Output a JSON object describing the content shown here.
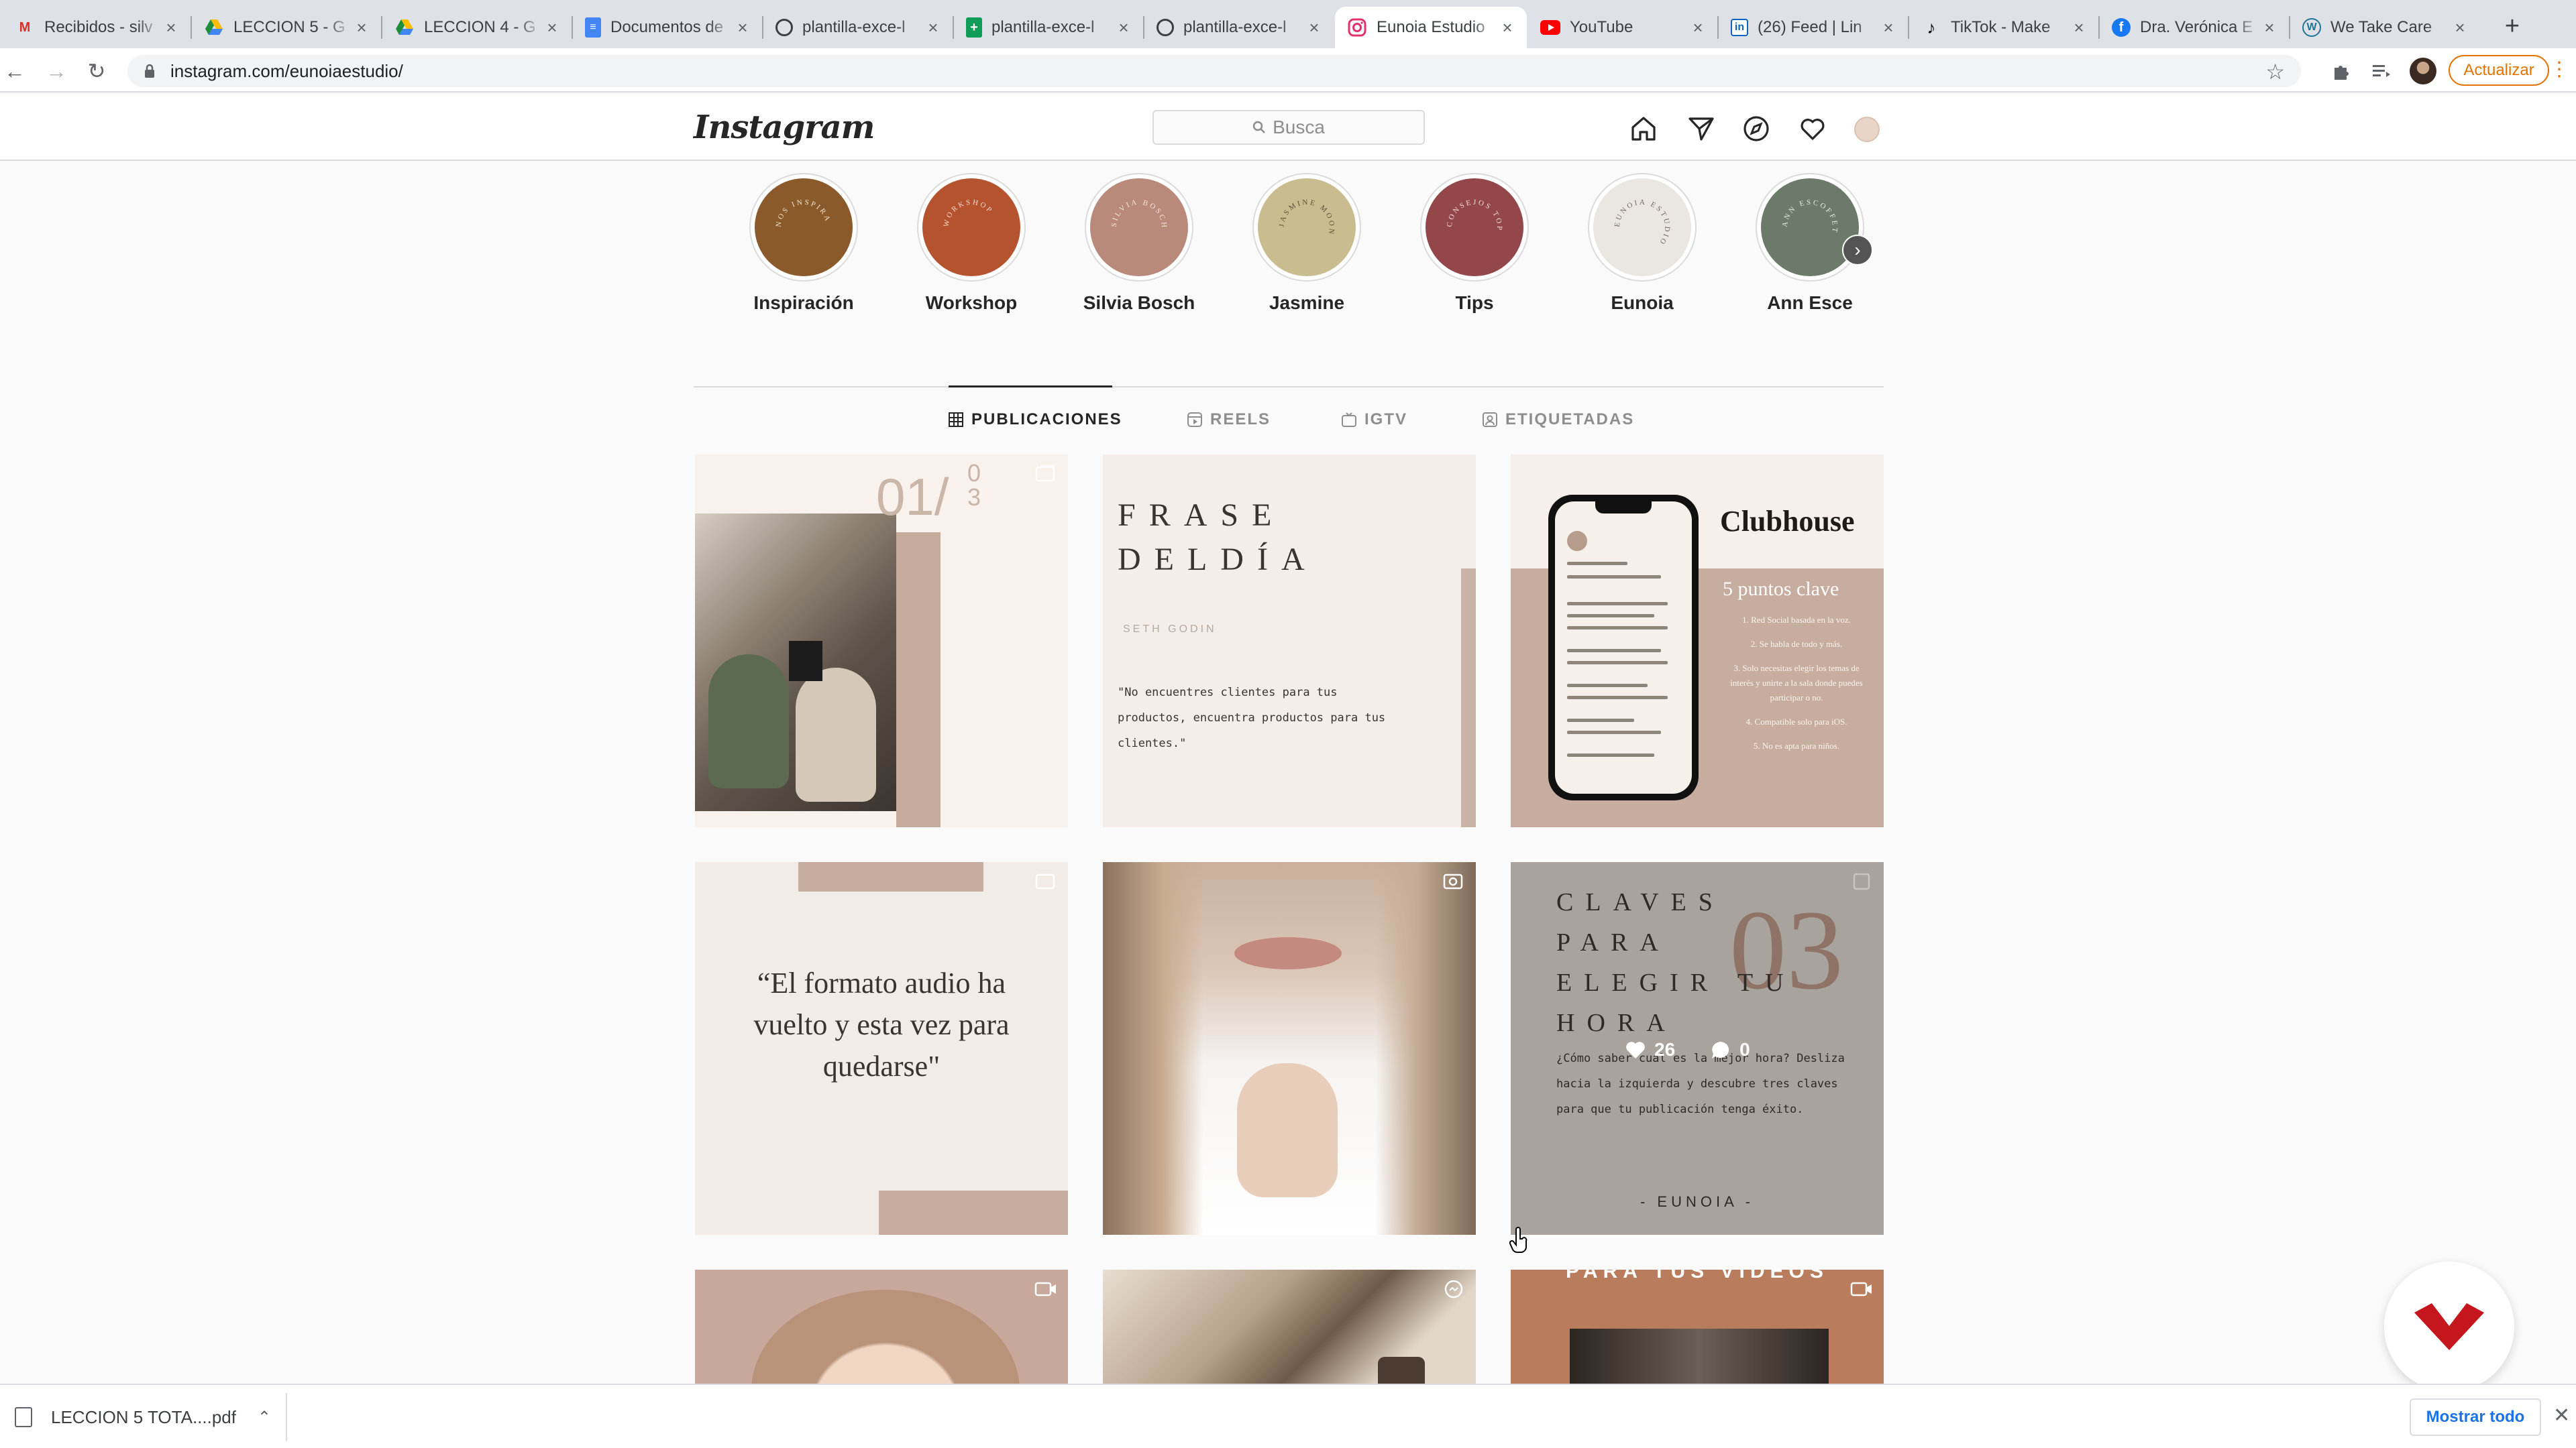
{
  "browser": {
    "tabs": [
      {
        "title": "Recibidos - silv",
        "icon": "gmail-icon",
        "color": "#d93025",
        "active": false
      },
      {
        "title": "LECCION 5 - G",
        "icon": "google-drive-icon",
        "color": "#1e8e3e",
        "active": false
      },
      {
        "title": "LECCION 4 - G",
        "icon": "google-drive-icon",
        "color": "#1e8e3e",
        "active": false
      },
      {
        "title": "Documentos de",
        "icon": "google-docs-icon",
        "color": "#4285f4",
        "active": false
      },
      {
        "title": "plantilla-exce-l",
        "icon": "globe-icon",
        "color": "#3c4043",
        "active": false
      },
      {
        "title": "plantilla-exce-l",
        "icon": "google-sheets-icon",
        "color": "#0f9d58",
        "active": false
      },
      {
        "title": "plantilla-exce-l",
        "icon": "globe-icon",
        "color": "#3c4043",
        "active": false
      },
      {
        "title": "Eunoia Estudio",
        "icon": "instagram-icon",
        "color": "#e1306c",
        "active": true
      },
      {
        "title": "YouTube",
        "icon": "youtube-icon",
        "color": "#ff0000",
        "active": false
      },
      {
        "title": "(26) Feed | Lin",
        "icon": "linkedin-icon",
        "color": "#0a66c2",
        "active": false
      },
      {
        "title": "TikTok - Make",
        "icon": "tiktok-icon",
        "color": "#000000",
        "active": false
      },
      {
        "title": "Dra. Verónica E",
        "icon": "facebook-icon",
        "color": "#1877f2",
        "active": false
      },
      {
        "title": "We Take Care",
        "icon": "wordpress-icon",
        "color": "#21759b",
        "active": false
      }
    ],
    "url": "instagram.com/eunoiaestudio/",
    "update_label": "Actualizar",
    "accent": "#e37400"
  },
  "instagram": {
    "logo": "Instagram",
    "search_placeholder": "Busca",
    "highlights": [
      {
        "label": "Inspiración",
        "ring_text": "NOS INSPIRA",
        "color": "#8a5a2b",
        "text_color": "#f3e3cf"
      },
      {
        "label": "Workshop",
        "ring_text": "WORKSHOP",
        "color": "#b5532f",
        "text_color": "#f6dccf"
      },
      {
        "label": "Silvia Bosch",
        "ring_text": "SILVIA BOSCH",
        "color": "#b9897a",
        "text_color": "#f7e6dd"
      },
      {
        "label": "Jasmine",
        "ring_text": "JASMINE MOON",
        "color": "#c9bd8f",
        "text_color": "#5a5238"
      },
      {
        "label": "Tips",
        "ring_text": "CONSEJOS TOP",
        "color": "#93474a",
        "text_color": "#f5dcdb"
      },
      {
        "label": "Eunoia",
        "ring_text": "EUNOIA ESTUDIO",
        "color": "#eae6e2",
        "text_color": "#6e6761"
      },
      {
        "label": "Ann Esce",
        "ring_text": "ANN ESCOFFET",
        "color": "#6c7a69",
        "text_color": "#e6ebe3"
      }
    ],
    "tabs": [
      {
        "label": "PUBLICACIONES",
        "active": true
      },
      {
        "label": "REELS",
        "active": false
      },
      {
        "label": "IGTV",
        "active": false
      },
      {
        "label": "ETIQUETADAS",
        "active": false
      }
    ],
    "posts": {
      "p1": {
        "number": "01/",
        "number_small": "0\n3"
      },
      "p2": {
        "title": "FRASE\nDELDÍA",
        "author": "SETH GODIN",
        "quote": "\"No encuentres clientes para tus productos, encuentra productos para tus clientes.\""
      },
      "p3": {
        "title": "Clubhouse",
        "subtitle": "5 puntos clave",
        "points": [
          "1. Red Social basada en la voz.",
          "2. Se habla de todo y más.",
          "3. Solo necesitas elegir los temas de interés y unirte a la sala donde puedes participar o no.",
          "4. Compatible solo para iOS.",
          "5. No es apta para niños."
        ]
      },
      "p4": {
        "quote": "“El formato audio ha vuelto y esta vez para quedarse\""
      },
      "p6": {
        "title": "CLAVES\nPARA\nELEGIR TU\nHORA",
        "big_number": "03",
        "text": "¿Cómo saber cuál es la mejor hora? Desliza hacia la izquierda y descubre tres claves  para que tu publicación tenga éxito.",
        "brand": "- EUNOIA -",
        "likes": "26",
        "comments": "0"
      },
      "p9": {
        "title": "PARA TUS VIDEOS"
      }
    }
  },
  "downloads": {
    "file_name": "LECCION 5 TOTA....pdf",
    "show_all": "Mostrar todo"
  }
}
